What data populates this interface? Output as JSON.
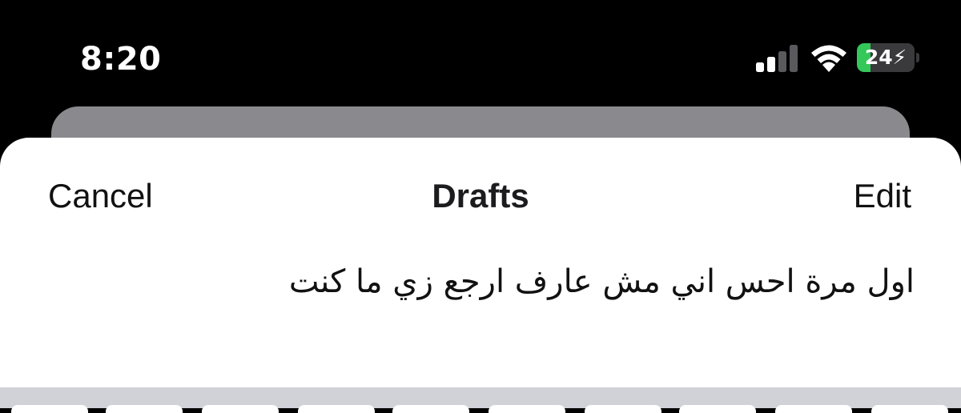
{
  "status_bar": {
    "time": "8:20",
    "battery_level": "24",
    "battery_percent": 24,
    "signal_bars_active": 2,
    "signal_bars_total": 4,
    "icons": [
      "cellular-signal-icon",
      "wifi-icon",
      "battery-charging-icon"
    ]
  },
  "sheet": {
    "nav": {
      "cancel_label": "Cancel",
      "title": "Drafts",
      "edit_label": "Edit"
    },
    "drafts": [
      {
        "text": "اول مرة احس اني مش عارف ارجع زي ما كنت"
      }
    ]
  },
  "colors": {
    "battery_green": "#34c759",
    "sheet_background": "#ffffff",
    "status_background": "#000000",
    "keyboard_background": "#d1d2d8"
  }
}
